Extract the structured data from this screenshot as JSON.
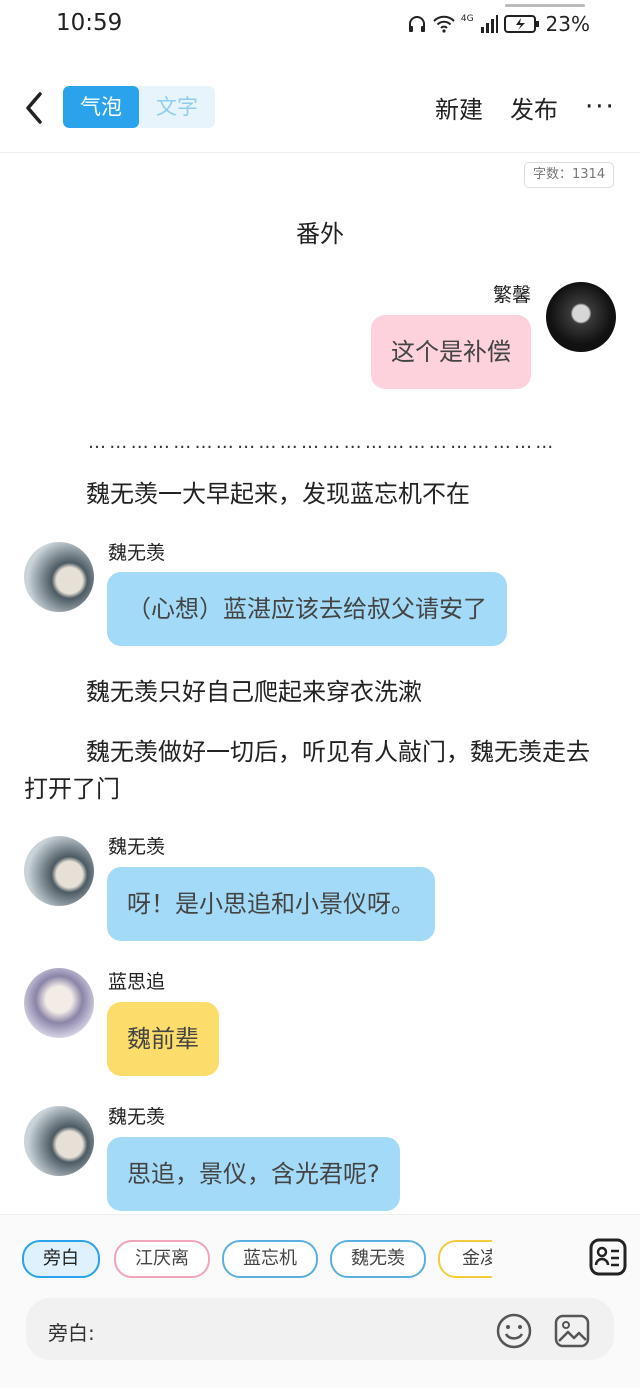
{
  "status": {
    "time": "10:59",
    "battery": "23%",
    "network": "4G"
  },
  "toolbar": {
    "mode_bubble": "气泡",
    "mode_text": "文字",
    "new_label": "新建",
    "publish_label": "发布",
    "more_label": "···"
  },
  "word_count": "字数：1314",
  "story_title": "番外",
  "messages": [
    {
      "speaker": "繁馨",
      "text": "这个是补偿"
    },
    {
      "narration": "魏无羡一大早起来，发现蓝忘机不在"
    },
    {
      "speaker": "魏无羡",
      "text": "（心想）蓝湛应该去给叔父请安了"
    },
    {
      "narration": "魏无羡只好自己爬起来穿衣洗漱"
    },
    {
      "narration": "魏无羡做好一切后，听见有人敲门，魏无羡走去打开了门"
    },
    {
      "speaker": "魏无羡",
      "text": "呀！是小思追和小景仪呀。"
    },
    {
      "speaker": "蓝思追",
      "text": "魏前辈"
    },
    {
      "speaker": "魏无羡",
      "text": "思追，景仪，含光君呢?"
    }
  ],
  "roles": [
    "旁白",
    "江厌离",
    "蓝忘机",
    "魏无羡",
    "金凌"
  ],
  "role_colors": [
    "#2aa3ec",
    "#f0a5b8",
    "#5bb0e0",
    "#5bb0e0",
    "#f2cc3c"
  ],
  "input": {
    "label": "旁白:"
  },
  "icons": [
    "back-icon",
    "headphones-icon",
    "wifi-icon",
    "signal-icon",
    "battery-icon",
    "role-list-icon",
    "emoji-icon",
    "image-icon"
  ]
}
